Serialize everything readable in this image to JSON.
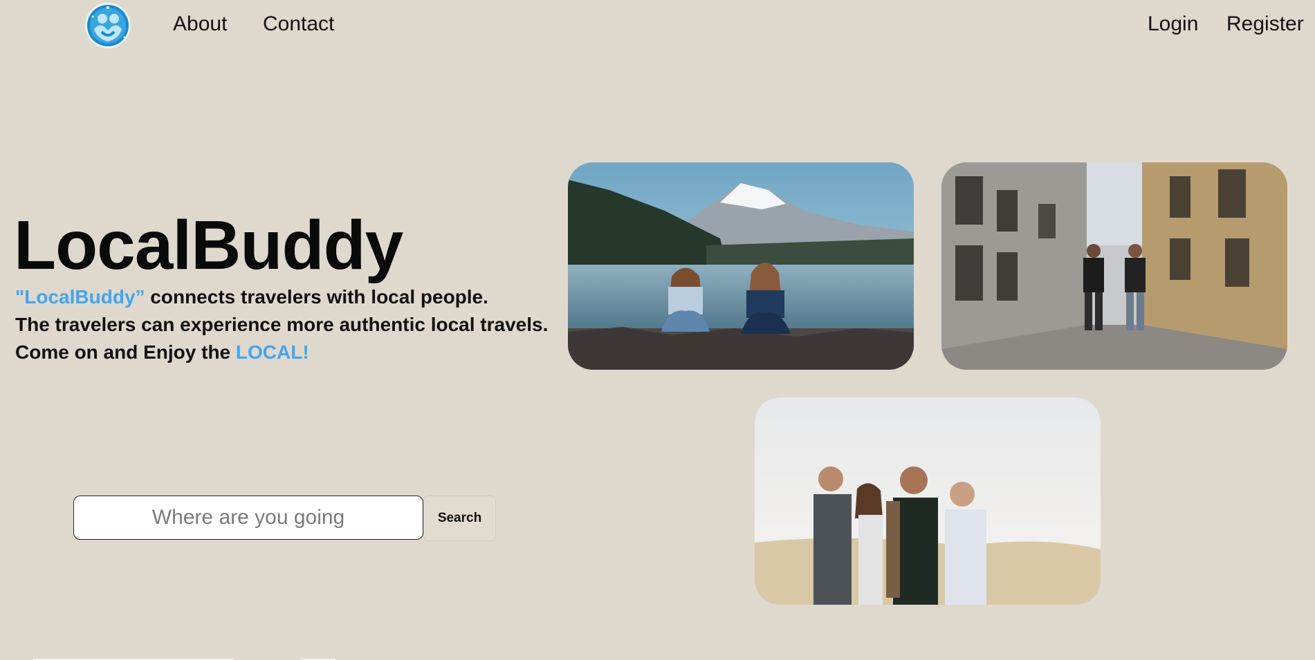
{
  "nav": {
    "logo_icon": "people-heart-logo-icon",
    "about": "About",
    "contact": "Contact",
    "login": "Login",
    "register": "Register"
  },
  "hero": {
    "title": "LocalBuddy",
    "line1_brand": "\"LocalBuddy”",
    "line1_rest": " connects travelers with local people.",
    "line2": "The travelers can experience more authentic local travels.",
    "line3_start": "Come on and Enjoy the ",
    "line3_accent": "LOCAL!"
  },
  "search": {
    "placeholder": "Where are you going",
    "value": "",
    "button_label": "Search"
  },
  "colors": {
    "background": "#dfd8cd",
    "accent": "#42a5f0",
    "text": "#111111"
  },
  "photos": {
    "lake_friends": "two-women-by-mountain-lake-photo",
    "street_walk": "two-men-walking-old-street-photo",
    "group_friends": "four-friends-laughing-photo"
  }
}
